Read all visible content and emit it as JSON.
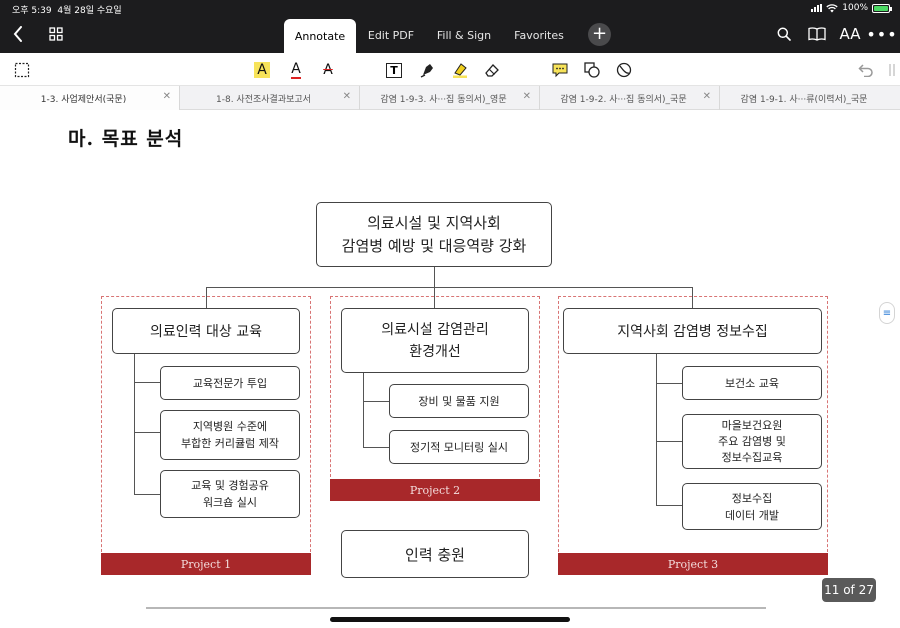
{
  "status_bar": {
    "time": "오후 5:39",
    "date": "4월 28일 수요일",
    "battery": "100%"
  },
  "nav": {
    "tabs": [
      {
        "label": "Annotate",
        "active": true
      },
      {
        "label": "Edit PDF",
        "active": false
      },
      {
        "label": "Fill & Sign",
        "active": false
      },
      {
        "label": "Favorites",
        "active": false
      }
    ],
    "add_label": "+",
    "text_size_label": "AA"
  },
  "toolbar": {
    "highlight_text_label": "A",
    "underline_text_label": "A",
    "strike_text_label": "A",
    "textbox_label": "T"
  },
  "doc_tabs": [
    {
      "label": "1-3. 사업제안서(국문)",
      "active": true
    },
    {
      "label": "1-8. 사전조사결과보고서",
      "active": false
    },
    {
      "label": "감염 1-9-3. 사···집 동의서)_영문",
      "active": false
    },
    {
      "label": "감염 1-9-2. 사···집 동의서)_국문",
      "active": false
    },
    {
      "label": "감염 1-9-1. 사···류(이력서)_국문",
      "active": false
    }
  ],
  "document": {
    "heading": "마. 목표 분석",
    "diagram": {
      "goal": "의료시설 및 지역사회\n감염병 예방 및 대응역량 강화",
      "projects": [
        {
          "title": "의료인력 대상 교육",
          "items": [
            "교육전문가 투입",
            "지역병원 수준에\n부합한 커리큘럼 제작",
            "교육 및 경험공유\n워크숍 실시"
          ],
          "footer": "Project 1"
        },
        {
          "title": "의료시설 감염관리\n환경개선",
          "items": [
            "장비 및 물품 지원",
            "정기적 모니터링 실시"
          ],
          "footer": "Project 2"
        },
        {
          "title": "지역사회 감염병 정보수집",
          "items": [
            "보건소 교육",
            "마을보건요원\n주요 감염병 및\n정보수집교육",
            "정보수집\n데이터 개발"
          ],
          "footer": "Project 3"
        }
      ],
      "extra": "인력 충원"
    }
  },
  "pager": {
    "label": "11 of 27"
  },
  "colors": {
    "accent_red": "#a8282a",
    "nav_bg": "#1c1c1e",
    "highlight_yellow": "#f7e35a"
  }
}
